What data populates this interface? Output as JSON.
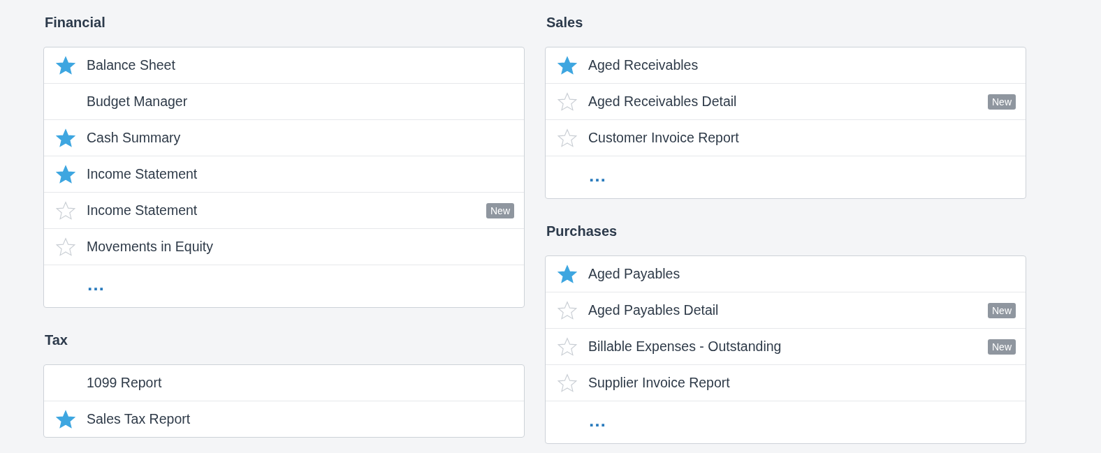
{
  "columns": [
    [
      {
        "title": "Financial",
        "items": [
          {
            "label": "Balance Sheet",
            "favorite": true
          },
          {
            "label": "Budget Manager"
          },
          {
            "label": "Cash Summary",
            "favorite": true
          },
          {
            "label": "Income Statement",
            "favorite": true
          },
          {
            "label": "Income Statement",
            "favorite": false,
            "badge": "New"
          },
          {
            "label": "Movements in Equity",
            "favorite": false
          }
        ],
        "more": "…"
      },
      {
        "title": "Tax",
        "items": [
          {
            "label": "1099 Report"
          },
          {
            "label": "Sales Tax Report",
            "favorite": true
          }
        ]
      }
    ],
    [
      {
        "title": "Sales",
        "items": [
          {
            "label": "Aged Receivables",
            "favorite": true
          },
          {
            "label": "Aged Receivables Detail",
            "favorite": false,
            "badge": "New"
          },
          {
            "label": "Customer Invoice Report",
            "favorite": false
          }
        ],
        "more": "…"
      },
      {
        "title": "Purchases",
        "items": [
          {
            "label": "Aged Payables",
            "favorite": true
          },
          {
            "label": "Aged Payables Detail",
            "favorite": false,
            "badge": "New"
          },
          {
            "label": "Billable Expenses - Outstanding",
            "favorite": false,
            "badge": "New"
          },
          {
            "label": "Supplier Invoice Report",
            "favorite": false
          }
        ],
        "more": "…"
      }
    ]
  ]
}
